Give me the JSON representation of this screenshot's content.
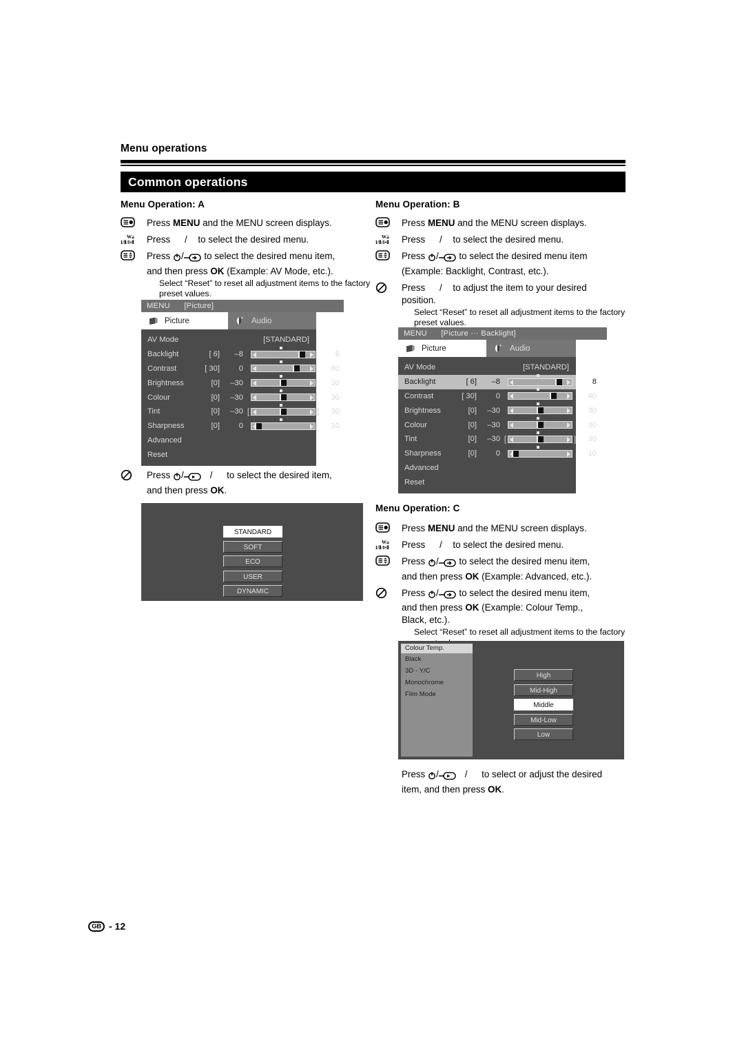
{
  "page": {
    "running_head": "Menu operations",
    "section_title": "Common operations",
    "footer_region": "GB",
    "footer_page": "- 12"
  },
  "operations": {
    "a": {
      "title": "Menu Operation: A",
      "steps": [
        {
          "icon": "menu-button-icon",
          "text_before": "Press ",
          "bold": "MENU",
          "text_after": " and the MENU screen displays."
        },
        {
          "icon": "sound-mode-icon",
          "text_before": "Press ",
          "mid": "/",
          "text_after": " to select the desired menu."
        },
        {
          "icon": "updown-button-icon",
          "text_before": "Press ",
          "keys": "power/input",
          "text_after": " to select the desired menu item,",
          "line2_before": "and then press ",
          "bold2": "OK",
          "line2_after": " (Example: AV Mode, etc.).",
          "note": "Select “Reset” to reset all adjustment items to the factory preset values."
        }
      ],
      "step_after": {
        "icon": "no-entry-icon",
        "text_before": "Press ",
        "keys": "power/enter",
        "mid": "/",
        "text_after": " to select the desired item,",
        "line2_before": "and then press ",
        "bold2": "OK",
        "line2_after": "."
      }
    },
    "b": {
      "title": "Menu Operation: B",
      "steps": [
        {
          "icon": "menu-button-icon",
          "text_before": "Press ",
          "bold": "MENU",
          "text_after": " and the MENU screen displays."
        },
        {
          "icon": "sound-mode-icon",
          "text_before": "Press ",
          "mid": "/",
          "text_after": " to select the desired menu."
        },
        {
          "icon": "updown-button-icon",
          "text_before": "Press ",
          "keys": "power/input",
          "text_after": " to select the desired menu item",
          "line2_after": "(Example: Backlight, Contrast, etc.)."
        },
        {
          "icon": "no-entry-icon",
          "text_before": "Press ",
          "mid": "/",
          "text_after": " to adjust the item to your desired",
          "line2_after": "position.",
          "note": "Select “Reset” to reset all adjustment items to the factory preset values."
        }
      ]
    },
    "c": {
      "title": "Menu Operation: C",
      "steps": [
        {
          "icon": "menu-button-icon",
          "text_before": "Press ",
          "bold": "MENU",
          "text_after": " and the MENU screen displays."
        },
        {
          "icon": "sound-mode-icon",
          "text_before": "Press ",
          "mid": "/",
          "text_after": " to select the desired menu."
        },
        {
          "icon": "updown-button-icon",
          "text_before": "Press ",
          "keys": "power/input",
          "text_after": " to select the desired menu item,",
          "line2_before": "and then press ",
          "bold2": "OK",
          "line2_after": " (Example: Advanced, etc.)."
        },
        {
          "icon": "no-entry-icon",
          "text_before": "Press ",
          "keys": "power/input",
          "text_after": " to select the desired menu item,",
          "line2_before": "and then press ",
          "bold2": "OK",
          "line2_after": " (Example: Colour Temp.,",
          "line3": "Black,  etc.).",
          "note": "Select “Reset” to reset all adjustment items to the factory preset values."
        }
      ],
      "step_after": {
        "text_before": "Press ",
        "keys": "power/enter",
        "mid": "/",
        "text_after": " to select or adjust the desired",
        "line2_before": "item, and then press ",
        "bold2": "OK",
        "line2_after": "."
      }
    }
  },
  "osd_picture": {
    "title_label": "MENU",
    "title_path": "[Picture]",
    "tabs": [
      {
        "label": "Picture",
        "icon": "picture-tab-icon",
        "active": true
      },
      {
        "label": "Audio",
        "icon": "audio-tab-icon",
        "active": false
      }
    ],
    "av_mode_label": "AV Mode",
    "av_mode_value": "[STANDARD]",
    "rows": [
      {
        "name": "Backlight",
        "current": "[ 6]",
        "min": "–8",
        "max": "8",
        "pos": 86,
        "selected": false
      },
      {
        "name": "Contrast",
        "current": "[ 30]",
        "min": "0",
        "max": "40",
        "pos": 75,
        "selected": false
      },
      {
        "name": "Brightness",
        "current": "[0]",
        "min": "–30",
        "max": "30",
        "pos": 50,
        "selected": false
      },
      {
        "name": "Colour",
        "current": "[0]",
        "min": "–30",
        "max": "30",
        "pos": 50,
        "selected": false
      },
      {
        "name": "Tint",
        "current": "[0]",
        "min": "–30",
        "max": "30",
        "pos": 50,
        "selected": false,
        "brackets": true
      },
      {
        "name": "Sharpness",
        "current": "[0]",
        "min": "0",
        "max": "10",
        "pos": 2,
        "selected": false
      }
    ],
    "tail_items": [
      "Advanced",
      "Reset"
    ]
  },
  "osd_picture_backlight": {
    "title_label": "MENU",
    "title_path": "[Picture ··· Backlight]",
    "tabs": [
      {
        "label": "Picture",
        "icon": "picture-tab-icon",
        "active": true
      },
      {
        "label": "Audio",
        "icon": "audio-tab-icon",
        "active": false
      }
    ],
    "av_mode_label": "AV Mode",
    "av_mode_value": "[STANDARD]",
    "rows": [
      {
        "name": "Backlight",
        "current": "[ 6]",
        "min": "–8",
        "max": "8",
        "pos": 86,
        "selected": true
      },
      {
        "name": "Contrast",
        "current": "[ 30]",
        "min": "0",
        "max": "40",
        "pos": 75,
        "selected": false
      },
      {
        "name": "Brightness",
        "current": "[0]",
        "min": "–30",
        "max": "30",
        "pos": 50,
        "selected": false
      },
      {
        "name": "Colour",
        "current": "[0]",
        "min": "–30",
        "max": "30",
        "pos": 50,
        "selected": false
      },
      {
        "name": "Tint",
        "current": "[0]",
        "min": "–30",
        "max": "30",
        "pos": 50,
        "selected": false,
        "brackets": true
      },
      {
        "name": "Sharpness",
        "current": "[0]",
        "min": "0",
        "max": "10",
        "pos": 2,
        "selected": false
      }
    ],
    "tail_items": [
      "Advanced",
      "Reset"
    ]
  },
  "osd_av_mode": {
    "choices": [
      {
        "label": "STANDARD",
        "selected": true
      },
      {
        "label": "SOFT",
        "selected": false
      },
      {
        "label": "ECO",
        "selected": false
      },
      {
        "label": "USER",
        "selected": false
      },
      {
        "label": "DYNAMIC",
        "selected": false
      }
    ]
  },
  "osd_colour_temp": {
    "menu_header": "Colour Temp.",
    "menu_items": [
      "Black",
      "3D - Y/C",
      "Monochrome",
      "Film Mode"
    ],
    "choices": [
      {
        "label": "High",
        "selected": false
      },
      {
        "label": "Mid-High",
        "selected": false
      },
      {
        "label": "Middle",
        "selected": true
      },
      {
        "label": "Mid-Low",
        "selected": false
      },
      {
        "label": "Low",
        "selected": false
      }
    ]
  },
  "colors": {
    "osd_title_bar": "#6f6f6f",
    "osd_body": "#4b4b4b",
    "osd_selected_row": "#bfbfbf",
    "tab_inactive": "#767676",
    "choice_bg": "#5e5e5e"
  }
}
